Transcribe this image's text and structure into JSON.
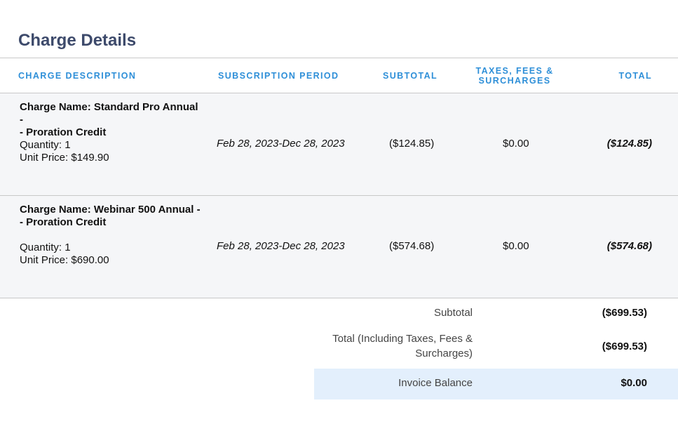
{
  "section": {
    "title": "Charge Details"
  },
  "columns": {
    "description": "CHARGE DESCRIPTION",
    "period": "SUBSCRIPTION PERIOD",
    "subtotal": "SUBTOTAL",
    "taxes_line1": "TAXES, FEES &",
    "taxes_line2": "SURCHARGES",
    "total": "TOTAL"
  },
  "charges": [
    {
      "name_line1": "Charge Name: Standard Pro Annual -",
      "name_line2": "- Proration Credit",
      "quantity": "Quantity: 1",
      "unit_price": "Unit Price: $149.90",
      "period": "Feb 28, 2023-Dec 28, 2023",
      "subtotal": "($124.85)",
      "taxes": "$0.00",
      "total": "($124.85)"
    },
    {
      "name_line1": "Charge Name: Webinar 500 Annual -",
      "name_line2": "- Proration Credit",
      "quantity": "Quantity: 1",
      "unit_price": "Unit Price: $690.00",
      "period": "Feb 28, 2023-Dec 28, 2023",
      "subtotal": "($574.68)",
      "taxes": "$0.00",
      "total": "($574.68)"
    }
  ],
  "summary": {
    "subtotal_label": "Subtotal",
    "subtotal_value": "($699.53)",
    "total_label_line1": "Total (Including Taxes, Fees &",
    "total_label_line2": "Surcharges)",
    "total_value": "($699.53)",
    "balance_label": "Invoice Balance",
    "balance_value": "$0.00"
  },
  "colors": {
    "title": "#3d4a6b",
    "header": "#2e8fd8",
    "row_bg": "#f5f6f8",
    "balance_bg": "#e3effc"
  }
}
